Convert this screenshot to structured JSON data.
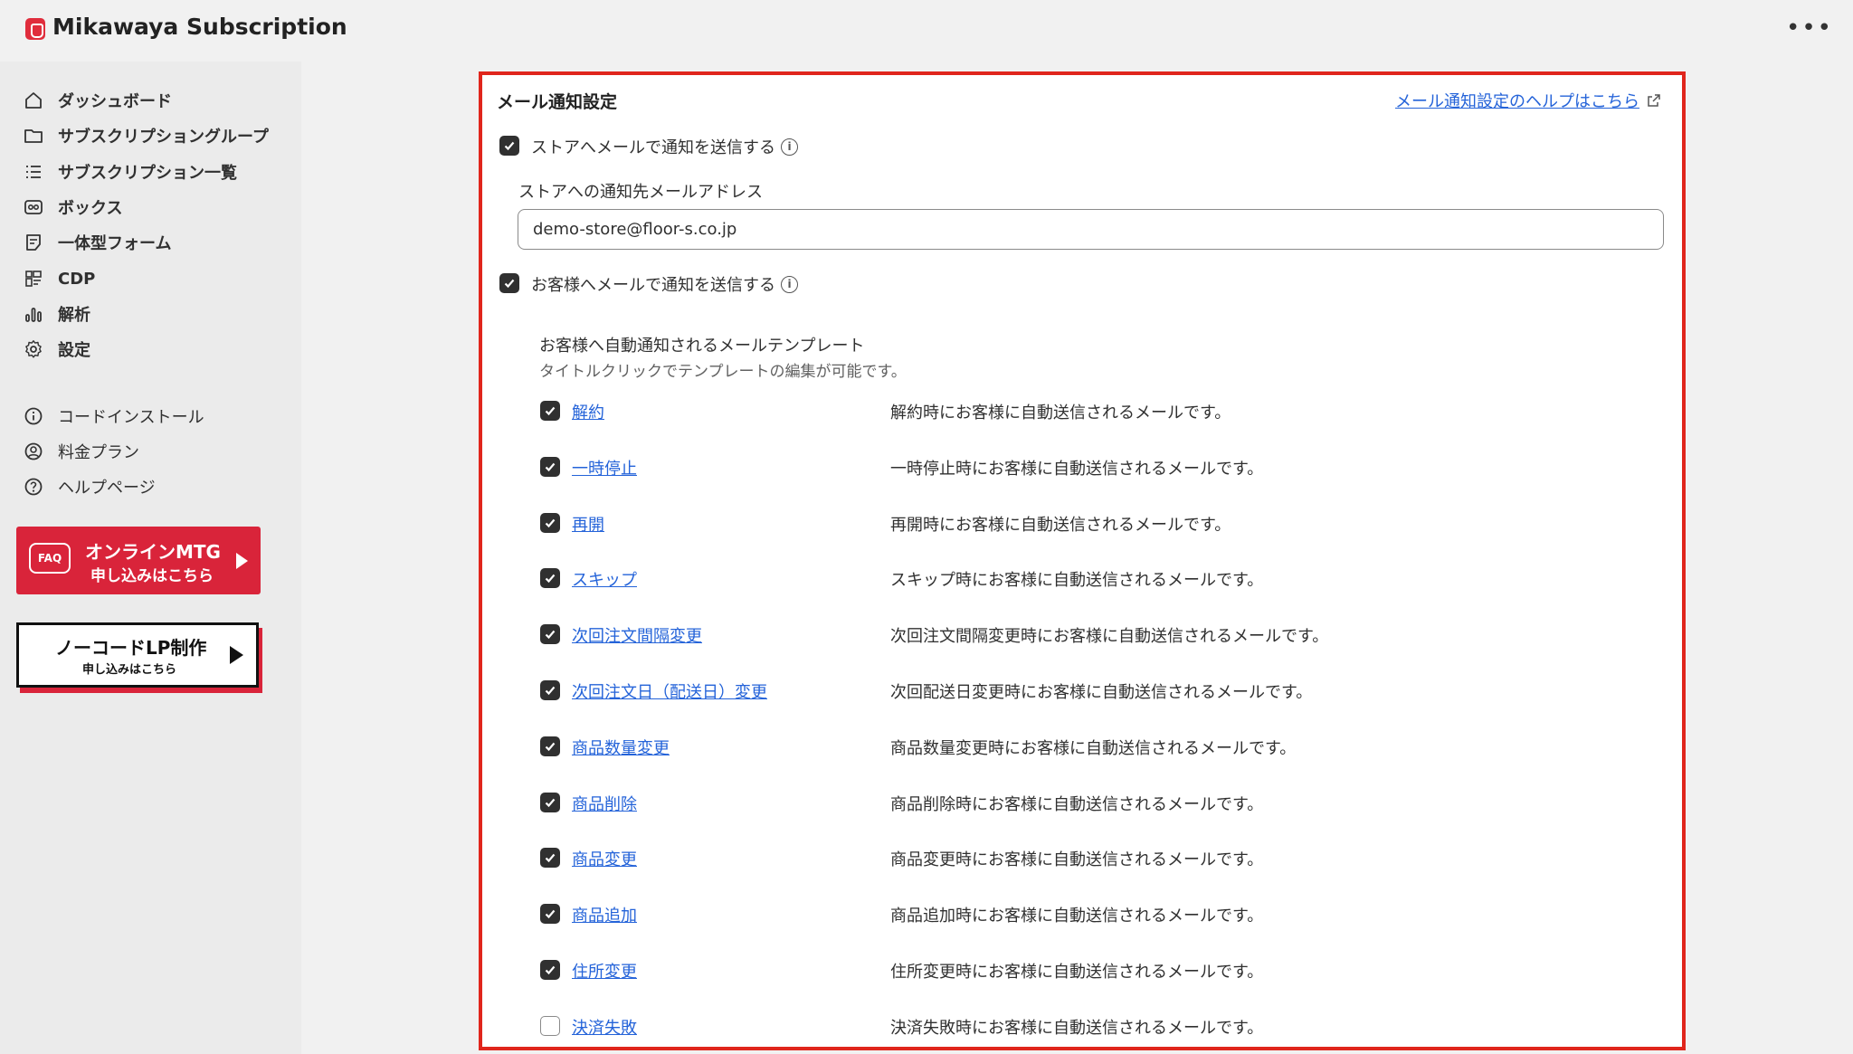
{
  "header": {
    "app_title": "Mikawaya Subscription",
    "more_label": "•••"
  },
  "sidebar": {
    "items": [
      {
        "label": "ダッシュボード",
        "icon": "home-icon"
      },
      {
        "label": "サブスクリプショングループ",
        "icon": "folder-icon"
      },
      {
        "label": "サブスクリプション一覧",
        "icon": "list-icon"
      },
      {
        "label": "ボックス",
        "icon": "box-icon"
      },
      {
        "label": "一体型フォーム",
        "icon": "form-icon"
      },
      {
        "label": "CDP",
        "icon": "cdp-icon"
      },
      {
        "label": "解析",
        "icon": "analytics-icon"
      },
      {
        "label": "設定",
        "icon": "gear-icon"
      }
    ],
    "secondary": [
      {
        "label": "コードインストール",
        "icon": "info-icon"
      },
      {
        "label": "料金プラン",
        "icon": "person-icon"
      },
      {
        "label": "ヘルプページ",
        "icon": "help-icon"
      }
    ],
    "banner_mtg": {
      "badge": "FAQ",
      "line1": "オンラインMTG",
      "line2": "申し込みはこちら"
    },
    "banner_lp": {
      "line1": "ノーコードLP制作",
      "line2": "申し込みはこちら"
    }
  },
  "main": {
    "title": "メール通知設定",
    "help_link": "メール通知設定のヘルプはこちら",
    "store_notify": {
      "label": "ストアへメールで通知を送信する",
      "checked": true
    },
    "store_email": {
      "label": "ストアへの通知先メールアドレス",
      "value": "demo-store@floor-s.co.jp"
    },
    "customer_notify": {
      "label": "お客様へメールで通知を送信する",
      "checked": true
    },
    "templates_heading": "お客様へ自動通知されるメールテンプレート",
    "templates_subheading": "タイトルクリックでテンプレートの編集が可能です。",
    "templates": [
      {
        "name": "解約",
        "desc": "解約時にお客様に自動送信されるメールです。",
        "checked": true
      },
      {
        "name": "一時停止",
        "desc": "一時停止時にお客様に自動送信されるメールです。",
        "checked": true
      },
      {
        "name": "再開",
        "desc": "再開時にお客様に自動送信されるメールです。",
        "checked": true
      },
      {
        "name": "スキップ",
        "desc": "スキップ時にお客様に自動送信されるメールです。",
        "checked": true
      },
      {
        "name": "次回注文間隔変更",
        "desc": "次回注文間隔変更時にお客様に自動送信されるメールです。",
        "checked": true
      },
      {
        "name": "次回注文日（配送日）変更",
        "desc": "次回配送日変更時にお客様に自動送信されるメールです。",
        "checked": true
      },
      {
        "name": "商品数量変更",
        "desc": "商品数量変更時にお客様に自動送信されるメールです。",
        "checked": true
      },
      {
        "name": "商品削除",
        "desc": "商品削除時にお客様に自動送信されるメールです。",
        "checked": true
      },
      {
        "name": "商品変更",
        "desc": "商品変更時にお客様に自動送信されるメールです。",
        "checked": true
      },
      {
        "name": "商品追加",
        "desc": "商品追加時にお客様に自動送信されるメールです。",
        "checked": true
      },
      {
        "name": "住所変更",
        "desc": "住所変更時にお客様に自動送信されるメールです。",
        "checked": true
      },
      {
        "name": "決済失敗",
        "desc": "決済失敗時にお客様に自動送信されるメールです。",
        "checked": false
      }
    ]
  },
  "colors": {
    "accent_red": "#e0261c",
    "link_blue": "#2463d9",
    "checkbox_dark": "#303030"
  }
}
